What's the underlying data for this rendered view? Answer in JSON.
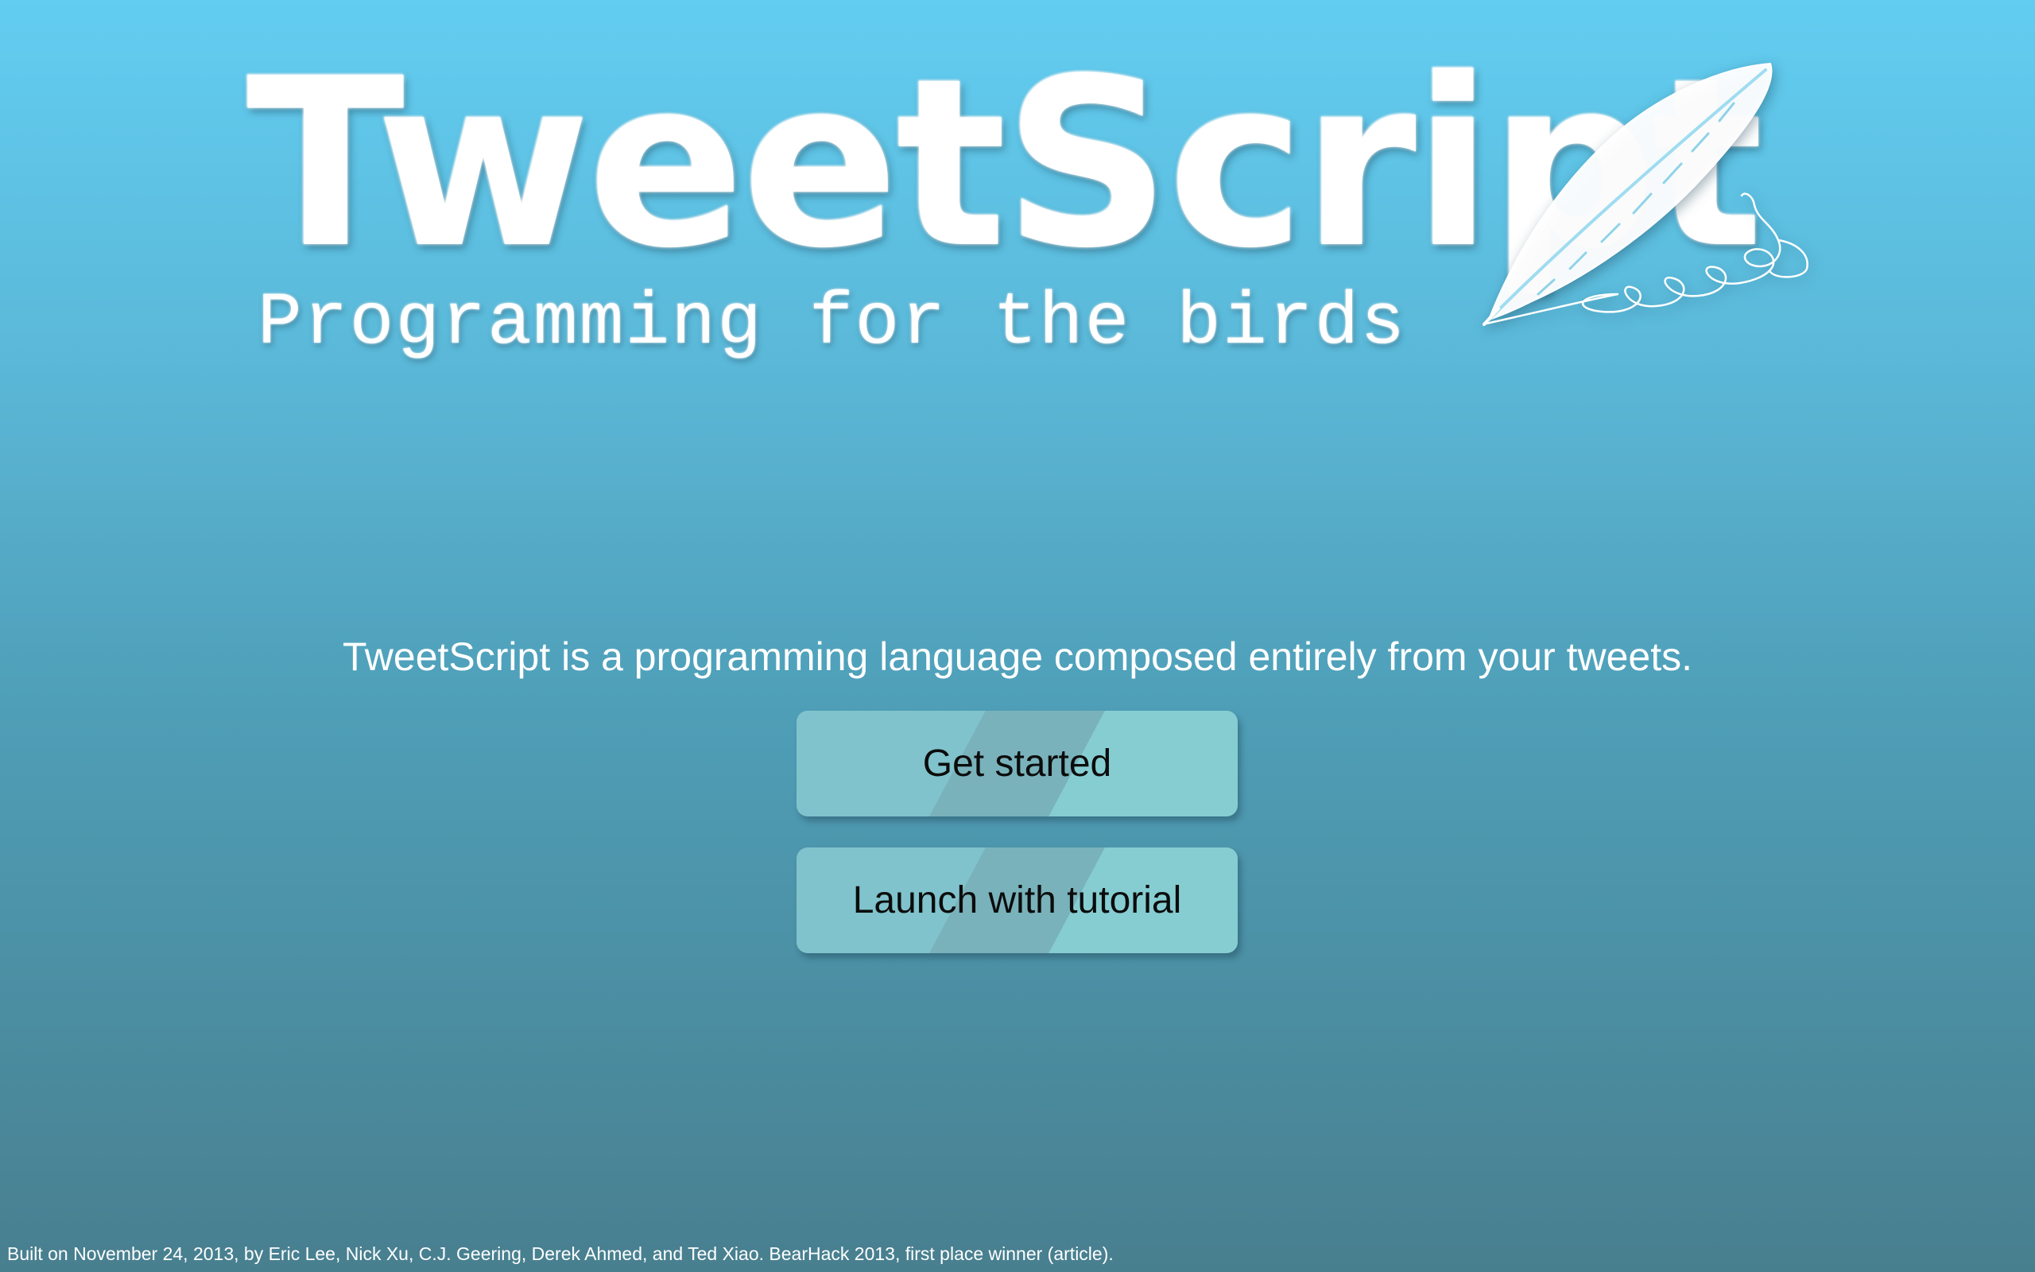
{
  "logo": {
    "title": "TweetScript",
    "tagline": "Programming for the birds"
  },
  "main": {
    "description": "TweetScript is a programming language composed entirely from your tweets.",
    "get_started_label": "Get started",
    "tutorial_label": "Launch with tutorial"
  },
  "footer": {
    "text_before_link": "Built on November 24, 2013, by Eric Lee, Nick Xu, C.J. Geering, Derek Ahmed, and Ted Xiao. BearHack 2013, first place winner (",
    "link_label": "article",
    "text_after_link": ")."
  },
  "icons": {
    "quill": "quill-pen-icon"
  },
  "colors": {
    "background_top": "#62cdf1",
    "background_bottom": "#487f8f",
    "button": "#80c3cc",
    "button_text": "#0c0c0c",
    "text": "#ffffff"
  }
}
